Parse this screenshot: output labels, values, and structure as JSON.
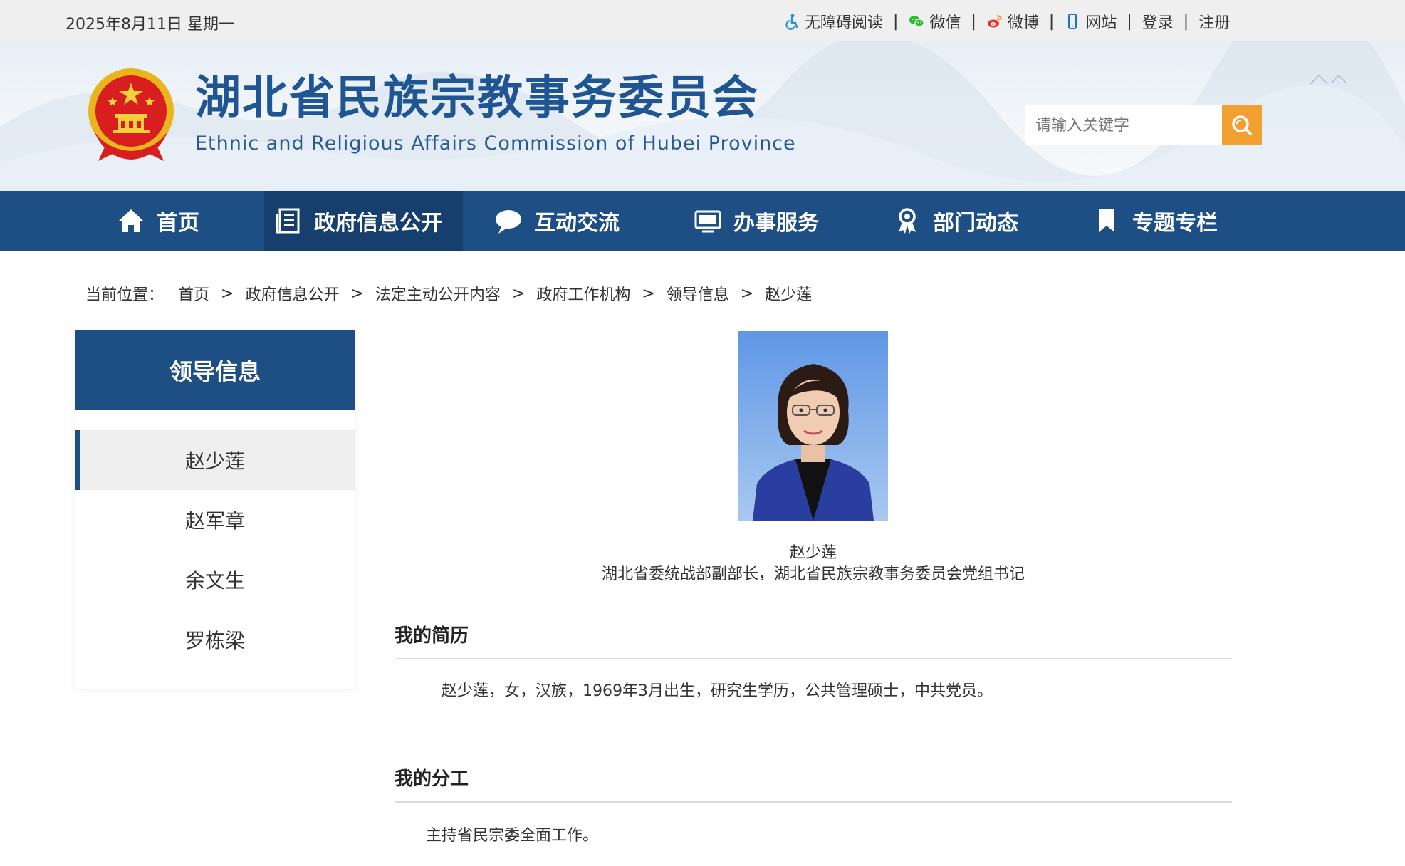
{
  "topbar": {
    "date": "2025年8月11日 星期一",
    "links": [
      {
        "label": "无障碍阅读",
        "icon": "accessibility-icon"
      },
      {
        "label": "微信",
        "icon": "wechat-icon"
      },
      {
        "label": "微博",
        "icon": "weibo-icon"
      },
      {
        "label": "网站",
        "icon": "mobile-icon"
      },
      {
        "label": "登录",
        "icon": ""
      },
      {
        "label": "注册",
        "icon": ""
      }
    ]
  },
  "header": {
    "title": "湖北省民族宗教事务委员会",
    "subtitle": "Ethnic and Religious Affairs Commission of Hubei Province",
    "search_placeholder": "请输入关键字",
    "emblem_icon": "national-emblem-icon"
  },
  "nav": {
    "items": [
      {
        "label": "首页",
        "icon": "home-icon"
      },
      {
        "label": "政府信息公开",
        "icon": "document-icon",
        "active": true
      },
      {
        "label": "互动交流",
        "icon": "chat-bubble-icon"
      },
      {
        "label": "办事服务",
        "icon": "monitor-icon"
      },
      {
        "label": "部门动态",
        "icon": "award-icon"
      },
      {
        "label": "专题专栏",
        "icon": "bookmark-icon"
      }
    ]
  },
  "breadcrumb": {
    "prefix": "当前位置：",
    "items": [
      "首页",
      "政府信息公开",
      "法定主动公开内容",
      "政府工作机构",
      "领导信息",
      "赵少莲"
    ]
  },
  "sidebar": {
    "title": "领导信息",
    "items": [
      {
        "label": "赵少莲",
        "active": true
      },
      {
        "label": "赵军章"
      },
      {
        "label": "余文生"
      },
      {
        "label": "罗栋梁"
      }
    ]
  },
  "profile": {
    "name": "赵少莲",
    "position": "湖北省委统战部副部长，湖北省民族宗教事务委员会党组书记",
    "bio_title": "我的简历",
    "bio_text": "赵少莲，女，汉族，1969年3月出生，研究生学历，公共管理硕士，中共党员。",
    "duty_title": "我的分工",
    "duty_text": "主持省民宗委全面工作。"
  },
  "colors": {
    "brand_blue": "#1d4f85",
    "nav_active": "#163f6d",
    "search_button": "#f3a033",
    "title_blue": "#1f5592"
  }
}
